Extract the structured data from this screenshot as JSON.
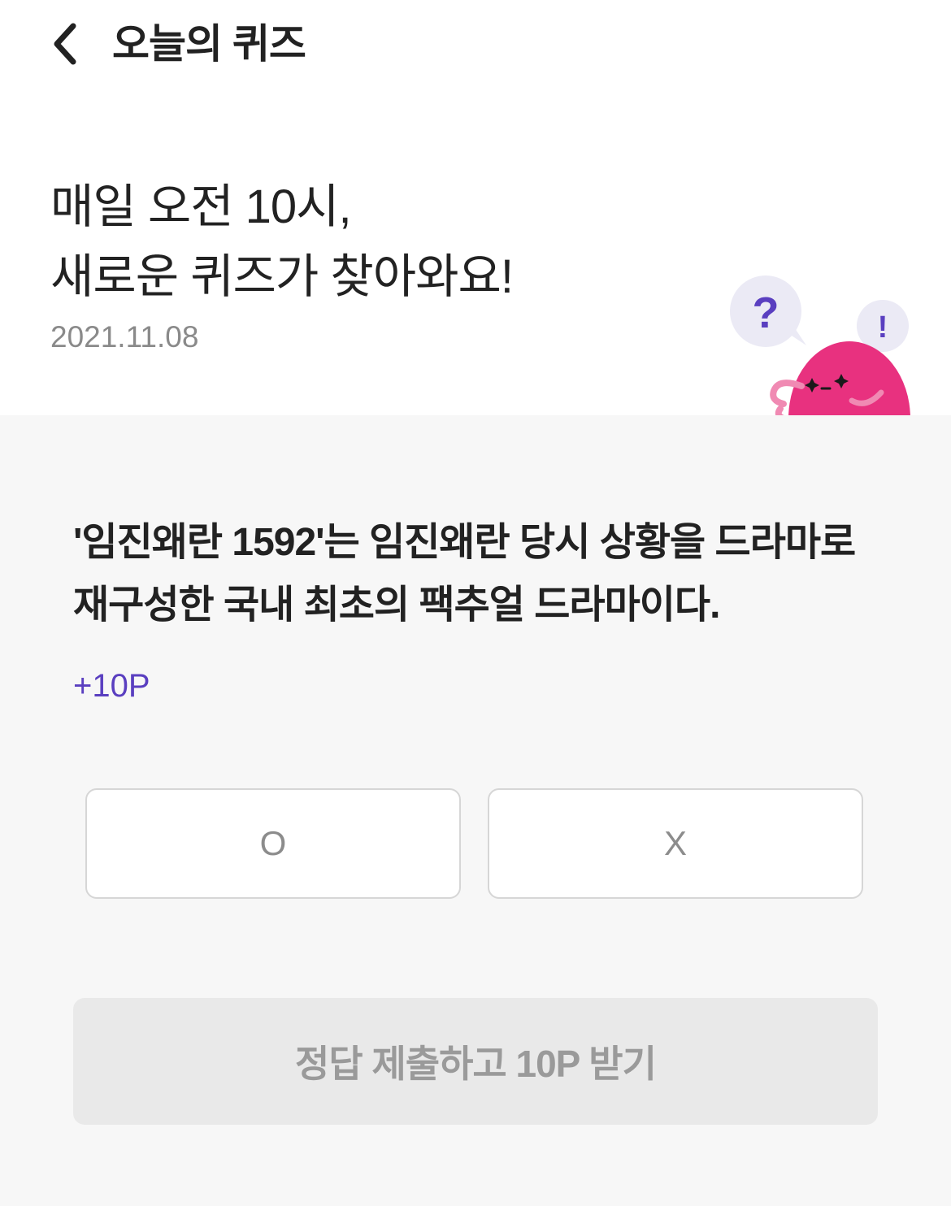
{
  "header": {
    "back_icon": "chevron-left-icon",
    "title": "오늘의 퀴즈"
  },
  "hero": {
    "headline_line1": "매일 오전 10시,",
    "headline_line2": "새로운 퀴즈가 찾아와요!",
    "date": "2021.11.08",
    "mascot": {
      "question_mark": "?",
      "exclamation_mark": "!"
    }
  },
  "quiz": {
    "question": "'임진왜란 1592'는 임진왜란 당시 상황을 드라마로 재구성한 국내 최초의 팩추얼 드라마이다.",
    "points": "+10P",
    "options": [
      "O",
      "X"
    ],
    "submit_label": "정답 제출하고 10P 받기"
  },
  "colors": {
    "accent": "#5a3fc0",
    "mascot_pink": "#e8317f",
    "background_gray": "#f7f7f7",
    "button_disabled": "#e9e9e9"
  }
}
